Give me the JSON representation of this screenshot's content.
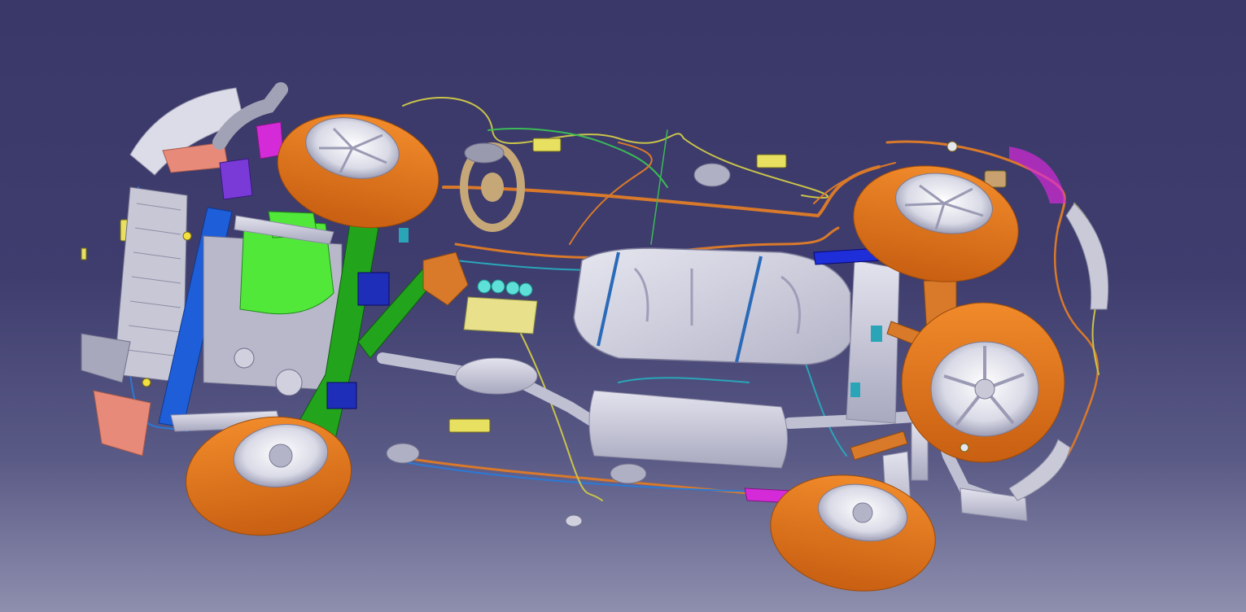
{
  "viewport": {
    "background_top": "#3a3868",
    "background_bottom": "#8e8fae"
  },
  "colors": {
    "tire": "#e2761c",
    "tire_dark": "#b85a10",
    "rim": "#e6e7f0",
    "body_metal": "#c9c9d8",
    "subframe_green": "#22a51c",
    "bumper_blue": "#1e5ed8",
    "engine_green": "#52e83a",
    "wire_orange": "#d9792a",
    "wire_teal": "#2aa5b8",
    "wire_yellow": "#d8d04a",
    "wire_green": "#3bbb55",
    "connector_yellow": "#e8e060",
    "magenta": "#d52ad8",
    "salmon": "#e88a7a"
  },
  "model_parts": [
    {
      "icon": "wheel-front-left-icon"
    },
    {
      "icon": "wheel-front-right-icon"
    },
    {
      "icon": "wheel-rear-left-icon"
    },
    {
      "icon": "wheel-rear-right-icon"
    },
    {
      "icon": "fuel-tank-icon"
    },
    {
      "icon": "muffler-icon"
    },
    {
      "icon": "catalytic-converter-icon"
    },
    {
      "icon": "radiator-icon"
    },
    {
      "icon": "front-subframe-icon"
    },
    {
      "icon": "engine-block-icon"
    },
    {
      "icon": "steering-wheel-icon"
    },
    {
      "icon": "wiring-harness-icon"
    }
  ]
}
